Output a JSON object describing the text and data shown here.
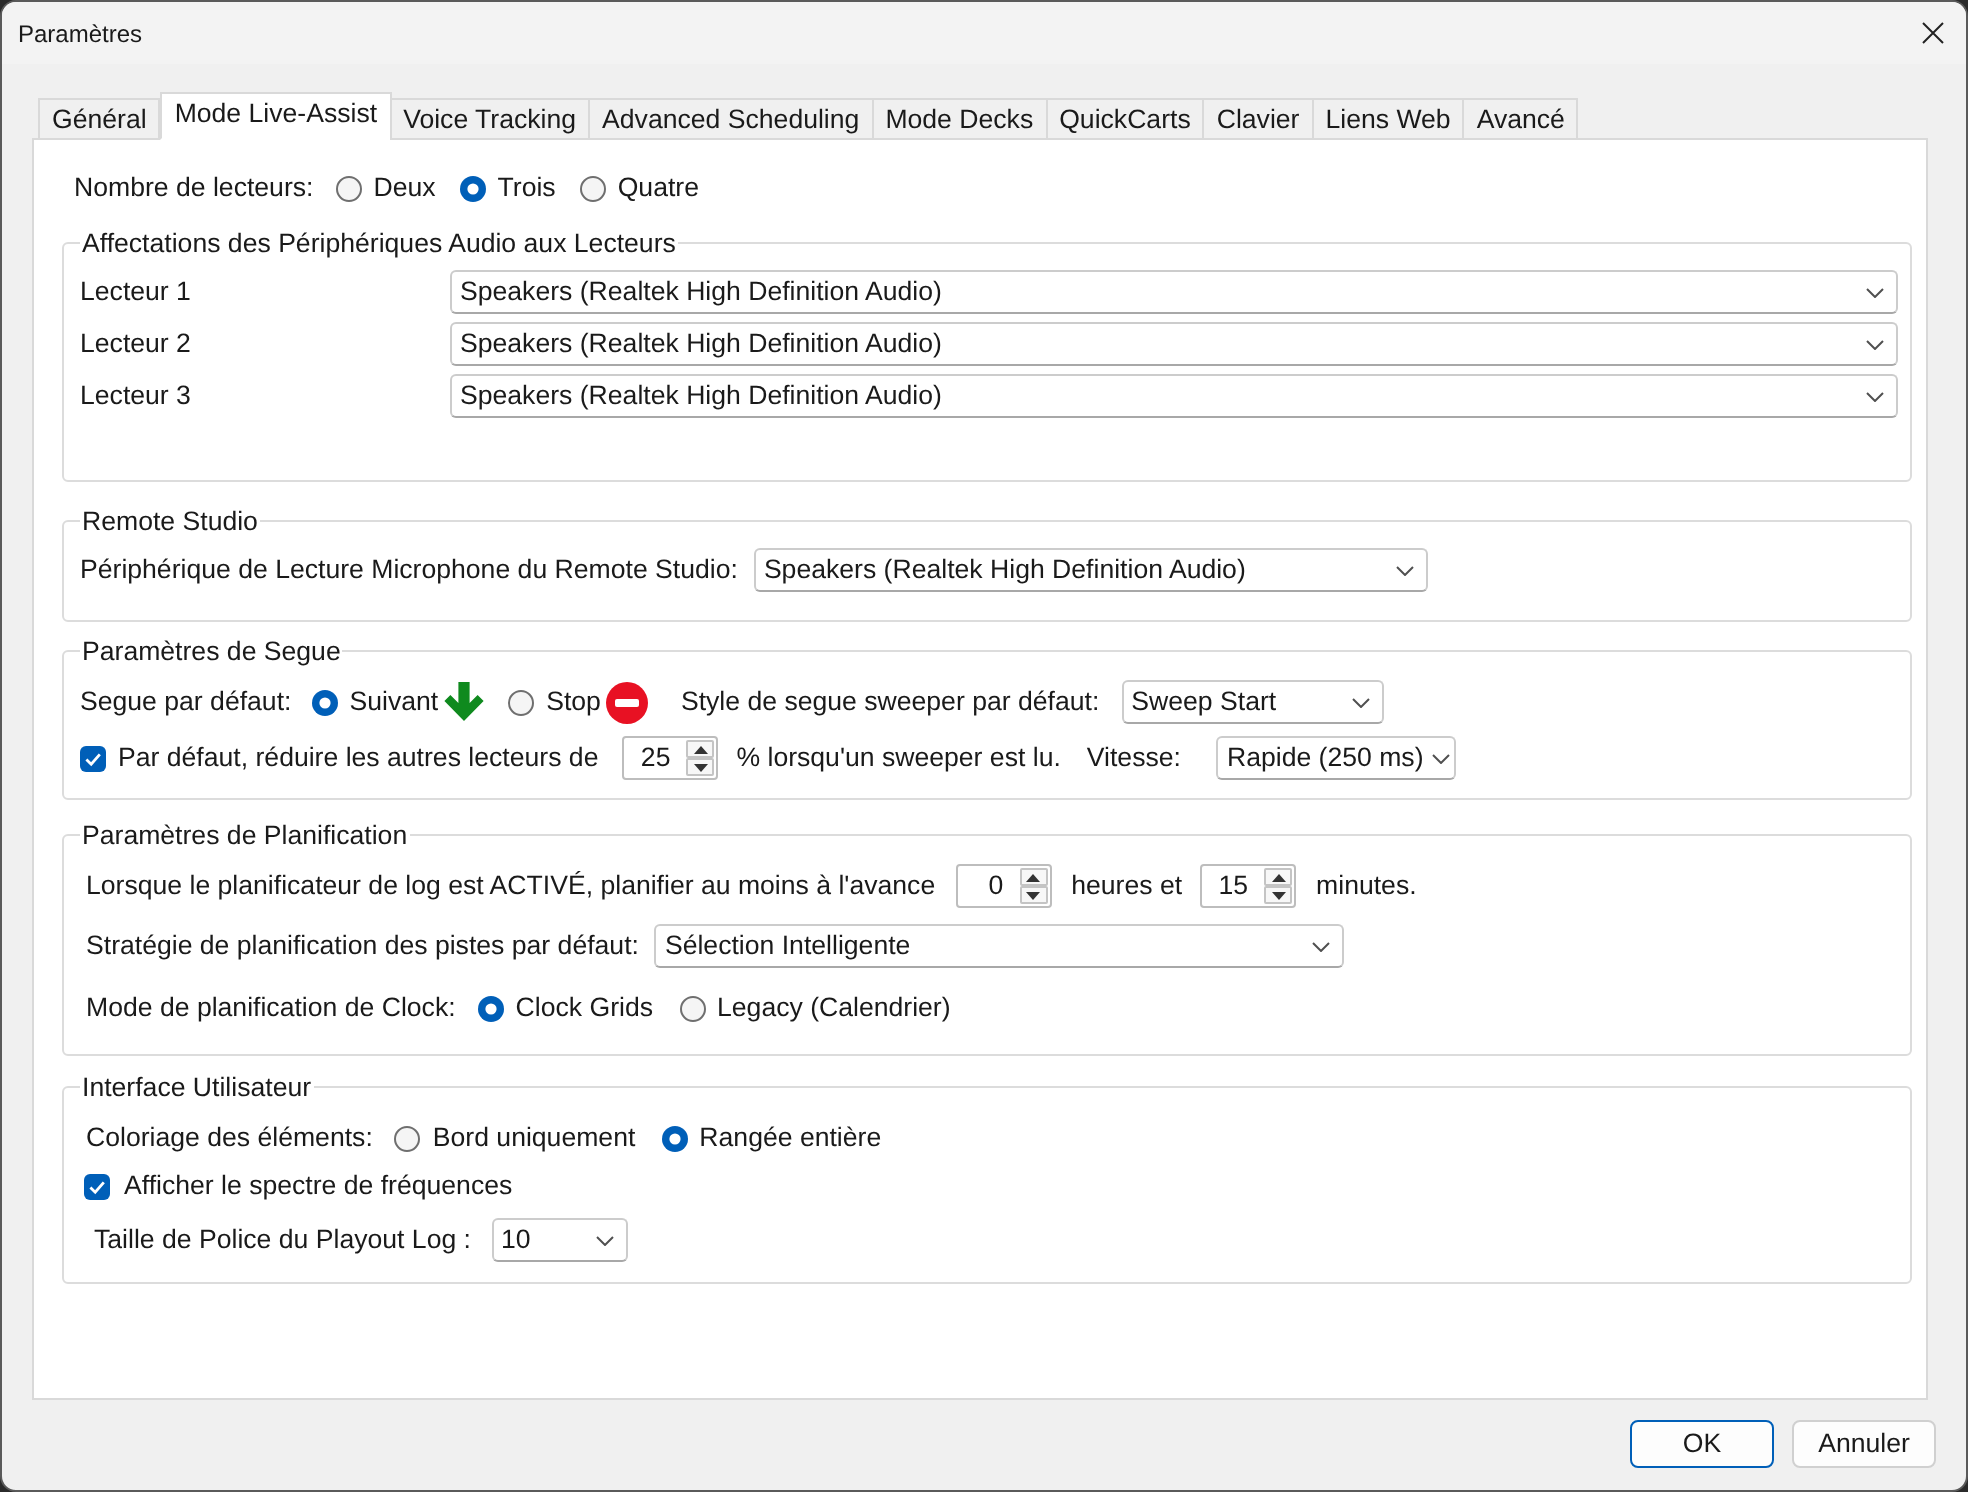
{
  "window": {
    "title": "Paramètres"
  },
  "tabs": [
    {
      "label": "Général",
      "selected": false
    },
    {
      "label": "Mode Live-Assist",
      "selected": true
    },
    {
      "label": "Voice Tracking",
      "selected": false
    },
    {
      "label": "Advanced Scheduling",
      "selected": false
    },
    {
      "label": "Mode Decks",
      "selected": false
    },
    {
      "label": "QuickCarts",
      "selected": false
    },
    {
      "label": "Clavier",
      "selected": false
    },
    {
      "label": "Liens Web",
      "selected": false
    },
    {
      "label": "Avancé",
      "selected": false
    }
  ],
  "player_count": {
    "label": "Nombre de lecteurs:",
    "options": [
      {
        "label": "Deux",
        "selected": false
      },
      {
        "label": "Trois",
        "selected": true
      },
      {
        "label": "Quatre",
        "selected": false
      }
    ]
  },
  "audio_assignments": {
    "title": "Affectations des Périphériques Audio aux Lecteurs",
    "rows": [
      {
        "label": "Lecteur 1",
        "value": "Speakers (Realtek High Definition Audio)"
      },
      {
        "label": "Lecteur 2",
        "value": "Speakers (Realtek High Definition Audio)"
      },
      {
        "label": "Lecteur 3",
        "value": "Speakers (Realtek High Definition Audio)"
      }
    ]
  },
  "remote_studio": {
    "title": "Remote Studio",
    "label": "Périphérique de Lecture Microphone du Remote Studio:",
    "value": "Speakers (Realtek High Definition Audio)"
  },
  "segue": {
    "title": "Paramètres de Segue",
    "default_label": "Segue par défaut:",
    "default_options": [
      {
        "label": "Suivant",
        "selected": true
      },
      {
        "label": "Stop",
        "selected": false
      }
    ],
    "sweeper_style_label": "Style de segue sweeper par défaut:",
    "sweeper_style_value": "Sweep Start",
    "reduce_checked": true,
    "reduce_label": "Par défaut, réduire les autres lecteurs de",
    "reduce_value": "25",
    "reduce_suffix": "% lorsqu'un sweeper est lu.",
    "speed_label": "Vitesse:",
    "speed_value": "Rapide (250 ms)"
  },
  "scheduling": {
    "title": "Paramètres de Planification",
    "advance_label": "Lorsque le planificateur de log est ACTIVÉ, planifier au moins à l'avance",
    "hours_value": "0",
    "hours_label": "heures et",
    "minutes_value": "15",
    "minutes_label": "minutes.",
    "strategy_label": "Stratégie de planification des pistes par défaut:",
    "strategy_value": "Sélection Intelligente",
    "clock_mode_label": "Mode de planification de Clock:",
    "clock_mode_options": [
      {
        "label": "Clock Grids",
        "selected": true
      },
      {
        "label": "Legacy (Calendrier)",
        "selected": false
      }
    ]
  },
  "user_interface": {
    "title": "Interface Utilisateur",
    "coloring_label": "Coloriage des éléments:",
    "coloring_options": [
      {
        "label": "Bord uniquement",
        "selected": false
      },
      {
        "label": "Rangée entière",
        "selected": true
      }
    ],
    "spectrum_checked": true,
    "spectrum_label": "Afficher le spectre de fréquences",
    "font_size_label": "Taille de Police du Playout Log :",
    "font_size_value": "10"
  },
  "buttons": [
    {
      "label": "OK",
      "default": true
    },
    {
      "label": "Annuler",
      "default": false
    }
  ]
}
